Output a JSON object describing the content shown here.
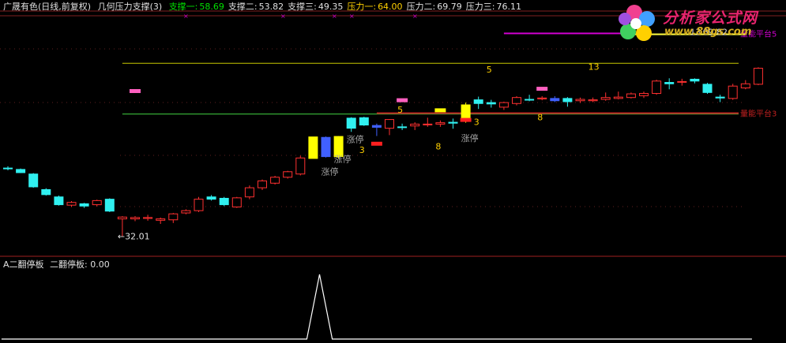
{
  "header": {
    "title": "广晟有色(日线,前复权)",
    "indicator_name": "几何压力支撑(3)",
    "values": [
      {
        "label": "支撑一:",
        "value": "58.69",
        "color": "#00e000"
      },
      {
        "label": "支撑二:",
        "value": "53.82",
        "color": "#e0e0e0"
      },
      {
        "label": "支撑三:",
        "value": "49.35",
        "color": "#e0e0e0"
      },
      {
        "label": "压力一:",
        "value": "64.00",
        "color": "#ffd000"
      },
      {
        "label": "压力二:",
        "value": "69.79",
        "color": "#e0e0e0"
      },
      {
        "label": "压力三:",
        "value": "76.11",
        "color": "#e0e0e0"
      }
    ],
    "corner_mark": "量"
  },
  "logo": {
    "title": "分析家公式网",
    "url": "www.88gs.com"
  },
  "subpanel": {
    "title": "A二翻停板",
    "label": "二翻停板:",
    "value": "0.00"
  },
  "chart_data": {
    "type": "candlestick",
    "price_range": [
      28.5,
      80.5
    ],
    "horizontal_lines": [
      {
        "name": "压力二",
        "value": 69.79,
        "color": "#c8c800",
        "from_index": 9
      },
      {
        "name": "支撑一",
        "value": 58.69,
        "color": "#40d040",
        "from_index": 9
      },
      {
        "name": "量能平台3",
        "value": 58.9,
        "color": "#c02020",
        "from_index": 29,
        "label": "量能平台3"
      },
      {
        "name": "量能平台5",
        "value": 76.3,
        "color": "#d000d0",
        "from_index": 39,
        "to_index": 49,
        "label": "量能平台5"
      },
      {
        "name": "量能平台5b",
        "value": 76.1,
        "color": "#ffff40",
        "from_index": 49,
        "to_index": 58
      }
    ],
    "candles": [
      {
        "o": 46.8,
        "h": 47.3,
        "l": 46.4,
        "c": 46.9,
        "color": "cyan"
      },
      {
        "o": 46.6,
        "h": 46.8,
        "l": 45.8,
        "c": 45.9,
        "color": "cyan"
      },
      {
        "o": 45.6,
        "h": 45.8,
        "l": 42.6,
        "c": 42.8,
        "color": "cyan"
      },
      {
        "o": 42.2,
        "h": 42.5,
        "l": 40.9,
        "c": 41.1,
        "color": "cyan"
      },
      {
        "o": 40.6,
        "h": 40.9,
        "l": 38.7,
        "c": 38.9,
        "color": "cyan"
      },
      {
        "o": 38.8,
        "h": 39.7,
        "l": 38.4,
        "c": 39.4,
        "color": "red"
      },
      {
        "o": 39.1,
        "h": 39.3,
        "l": 38.2,
        "c": 38.6,
        "color": "cyan"
      },
      {
        "o": 38.9,
        "h": 40.0,
        "l": 38.5,
        "c": 39.8,
        "color": "red"
      },
      {
        "o": 40.1,
        "h": 40.3,
        "l": 37.3,
        "c": 37.5,
        "color": "cyan"
      },
      {
        "o": 35.8,
        "h": 36.4,
        "l": 32.0,
        "c": 36.2,
        "color": "red"
      },
      {
        "o": 35.8,
        "h": 36.4,
        "l": 35.3,
        "c": 36.1,
        "color": "red"
      },
      {
        "o": 36.1,
        "h": 36.7,
        "l": 35.4,
        "c": 35.9,
        "color": "red"
      },
      {
        "o": 35.5,
        "h": 36.1,
        "l": 34.7,
        "c": 35.8,
        "color": "red"
      },
      {
        "o": 35.6,
        "h": 37.1,
        "l": 34.9,
        "c": 36.9,
        "color": "red"
      },
      {
        "o": 37.1,
        "h": 37.9,
        "l": 36.8,
        "c": 37.6,
        "color": "red"
      },
      {
        "o": 37.6,
        "h": 40.6,
        "l": 37.3,
        "c": 40.1,
        "color": "red"
      },
      {
        "o": 40.6,
        "h": 41.0,
        "l": 39.8,
        "c": 40.1,
        "color": "cyan"
      },
      {
        "o": 40.3,
        "h": 40.6,
        "l": 38.6,
        "c": 38.9,
        "color": "cyan"
      },
      {
        "o": 38.4,
        "h": 40.6,
        "l": 38.2,
        "c": 40.4,
        "color": "red"
      },
      {
        "o": 40.6,
        "h": 43.1,
        "l": 40.1,
        "c": 42.6,
        "color": "red"
      },
      {
        "o": 42.6,
        "h": 44.4,
        "l": 42.1,
        "c": 44.1,
        "color": "red"
      },
      {
        "o": 43.6,
        "h": 45.2,
        "l": 43.3,
        "c": 44.9,
        "color": "red"
      },
      {
        "o": 44.9,
        "h": 46.3,
        "l": 44.6,
        "c": 46.1,
        "color": "red"
      },
      {
        "o": 45.6,
        "h": 49.6,
        "l": 45.3,
        "c": 49.1,
        "color": "red"
      },
      {
        "o": 49.0,
        "h": 53.7,
        "l": 49.0,
        "c": 53.7,
        "color": "yellow"
      },
      {
        "o": 53.6,
        "h": 53.8,
        "l": 49.2,
        "c": 49.4,
        "color": "blue"
      },
      {
        "o": 49.4,
        "h": 53.9,
        "l": 48.9,
        "c": 53.8,
        "color": "yellow"
      },
      {
        "o": 55.6,
        "h": 58.0,
        "l": 54.8,
        "c": 57.8,
        "color": "cyan"
      },
      {
        "o": 57.9,
        "h": 58.1,
        "l": 56.1,
        "c": 56.3,
        "color": "cyan"
      },
      {
        "o": 55.8,
        "h": 56.6,
        "l": 53.9,
        "c": 56.2,
        "color": "blue"
      },
      {
        "o": 55.6,
        "h": 57.6,
        "l": 54.1,
        "c": 57.5,
        "color": "red"
      },
      {
        "o": 55.8,
        "h": 56.6,
        "l": 55.2,
        "c": 55.9,
        "color": "cyan"
      },
      {
        "o": 56.5,
        "h": 56.9,
        "l": 55.2,
        "c": 56.1,
        "color": "red"
      },
      {
        "o": 56.4,
        "h": 57.9,
        "l": 55.9,
        "c": 56.5,
        "color": "red"
      },
      {
        "o": 56.5,
        "h": 57.3,
        "l": 55.9,
        "c": 56.8,
        "color": "red"
      },
      {
        "o": 56.9,
        "h": 57.7,
        "l": 55.5,
        "c": 56.7,
        "color": "cyan"
      },
      {
        "o": 57.7,
        "h": 61.2,
        "l": 56.8,
        "c": 60.7,
        "color": "yellow"
      },
      {
        "o": 61.0,
        "h": 62.5,
        "l": 59.8,
        "c": 61.8,
        "color": "cyan"
      },
      {
        "o": 61.2,
        "h": 61.8,
        "l": 60.1,
        "c": 60.9,
        "color": "cyan"
      },
      {
        "o": 60.2,
        "h": 61.4,
        "l": 59.6,
        "c": 61.2,
        "color": "red"
      },
      {
        "o": 61.0,
        "h": 62.6,
        "l": 60.6,
        "c": 62.3,
        "color": "red"
      },
      {
        "o": 61.8,
        "h": 62.9,
        "l": 61.5,
        "c": 61.9,
        "color": "cyan"
      },
      {
        "o": 62.2,
        "h": 62.6,
        "l": 61.7,
        "c": 62.0,
        "color": "red"
      },
      {
        "o": 61.6,
        "h": 62.6,
        "l": 61.3,
        "c": 62.1,
        "color": "blue"
      },
      {
        "o": 62.1,
        "h": 62.4,
        "l": 60.3,
        "c": 61.4,
        "color": "cyan"
      },
      {
        "o": 61.6,
        "h": 62.3,
        "l": 61.1,
        "c": 61.9,
        "color": "red"
      },
      {
        "o": 61.6,
        "h": 62.3,
        "l": 61.3,
        "c": 61.8,
        "color": "red"
      },
      {
        "o": 61.9,
        "h": 63.4,
        "l": 61.6,
        "c": 62.3,
        "color": "red"
      },
      {
        "o": 62.1,
        "h": 63.6,
        "l": 61.9,
        "c": 62.4,
        "color": "red"
      },
      {
        "o": 62.3,
        "h": 63.4,
        "l": 62.1,
        "c": 63.1,
        "color": "red"
      },
      {
        "o": 62.7,
        "h": 63.6,
        "l": 62.2,
        "c": 63.2,
        "color": "red"
      },
      {
        "o": 63.2,
        "h": 66.2,
        "l": 62.9,
        "c": 65.9,
        "color": "red"
      },
      {
        "o": 65.3,
        "h": 66.5,
        "l": 64.1,
        "c": 65.6,
        "color": "cyan"
      },
      {
        "o": 65.8,
        "h": 66.4,
        "l": 64.9,
        "c": 65.7,
        "color": "red"
      },
      {
        "o": 66.3,
        "h": 66.5,
        "l": 65.4,
        "c": 65.9,
        "color": "cyan"
      },
      {
        "o": 65.2,
        "h": 65.5,
        "l": 63.1,
        "c": 63.4,
        "color": "cyan"
      },
      {
        "o": 62.4,
        "h": 62.9,
        "l": 61.3,
        "c": 62.2,
        "color": "cyan"
      },
      {
        "o": 62.1,
        "h": 65.3,
        "l": 61.8,
        "c": 64.8,
        "color": "red"
      },
      {
        "o": 64.4,
        "h": 66.1,
        "l": 64.1,
        "c": 65.3,
        "color": "red"
      },
      {
        "o": 65.2,
        "h": 68.9,
        "l": 65.0,
        "c": 68.7,
        "color": "red"
      }
    ],
    "markers": [
      {
        "index": 10,
        "price": 63.8,
        "type": "bar",
        "color": "#ff60c0"
      },
      {
        "index": 31,
        "price": 61.8,
        "type": "bar",
        "color": "#ff60c0"
      },
      {
        "index": 42,
        "price": 64.3,
        "type": "bar",
        "color": "#ff60c0"
      },
      {
        "index": 34,
        "price": 59.6,
        "type": "bar",
        "color": "#ffff00"
      },
      {
        "index": 29,
        "price": 52.3,
        "type": "bar",
        "color": "#ff2020"
      },
      {
        "index": 36,
        "price": 57.5,
        "type": "bar",
        "color": "#ff2020"
      }
    ],
    "labels": [
      {
        "text": "5",
        "index": 31,
        "price": 59.0,
        "color": "#ffd000"
      },
      {
        "text": "5",
        "index": 38,
        "price": 67.8,
        "color": "#ffd000"
      },
      {
        "text": "13",
        "index": 46,
        "price": 68.4,
        "color": "#ffd000"
      },
      {
        "text": "13",
        "index": 54,
        "price": 75.9,
        "color": "#e0e0e0"
      },
      {
        "text": "69.82",
        "index": 55,
        "price": 75.9,
        "color": "#e0e0e0"
      },
      {
        "text": "3",
        "index": 28,
        "price": 50.2,
        "color": "#ffd000"
      },
      {
        "text": "3",
        "index": 37,
        "price": 56.3,
        "color": "#ffd000"
      },
      {
        "text": "8",
        "index": 34,
        "price": 51.0,
        "color": "#ffd000"
      },
      {
        "text": "8",
        "index": 42,
        "price": 57.3,
        "color": "#ffd000"
      },
      {
        "text": "涨停",
        "index": 26,
        "price": 48.2,
        "color": "#a0a0a0"
      },
      {
        "text": "涨停",
        "index": 27,
        "price": 52.5,
        "color": "#a0a0a0"
      },
      {
        "text": "涨停",
        "index": 25,
        "price": 45.5,
        "color": "#a0a0a0"
      },
      {
        "text": "涨停",
        "index": 36,
        "price": 52.8,
        "color": "#a0a0a0"
      },
      {
        "text": "32.01",
        "index": 9,
        "price": 31.3,
        "color": "#e0e0e0"
      }
    ],
    "sub_series": {
      "name": "二翻停板",
      "values": [
        0,
        0,
        0,
        0,
        0,
        0,
        0,
        0,
        0,
        0,
        0,
        0,
        0,
        0,
        0,
        0,
        0,
        0,
        0,
        0,
        0,
        0,
        0,
        0,
        0,
        1,
        0,
        0,
        0,
        0,
        0,
        0,
        0,
        0,
        0,
        0,
        0,
        0,
        0,
        0,
        0,
        0,
        0,
        0,
        0,
        0,
        0,
        0,
        0,
        0,
        0,
        0,
        0,
        0,
        0,
        0,
        0,
        0,
        0,
        0
      ],
      "range": [
        0,
        1
      ]
    }
  }
}
